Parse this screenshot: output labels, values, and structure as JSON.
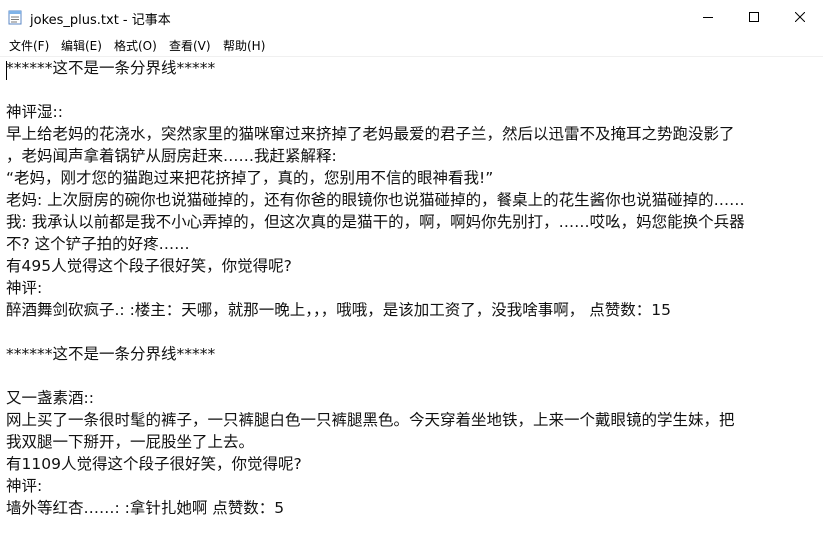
{
  "window": {
    "title": "jokes_plus.txt - 记事本",
    "icons": {
      "app": "notepad-icon",
      "minimize": "minimize-icon",
      "maximize": "maximize-icon",
      "close": "close-icon"
    }
  },
  "menu": {
    "items": [
      {
        "label": "文件(F)"
      },
      {
        "label": "编辑(E)"
      },
      {
        "label": "格式(O)"
      },
      {
        "label": "查看(V)"
      },
      {
        "label": "帮助(H)"
      }
    ]
  },
  "document": {
    "lines": [
      "******这不是一条分界线*****",
      "",
      "神评湿::",
      "早上给老妈的花浇水，突然家里的猫咪窜过来挤掉了老妈最爱的君子兰，然后以迅雷不及掩耳之势跑没影了",
      "，老妈闻声拿着锅铲从厨房赶来……我赶紧解释:",
      "“老妈，刚才您的猫跑过来把花挤掉了，真的，您别用不信的眼神看我!”",
      "老妈: 上次厨房的碗你也说猫碰掉的，还有你爸的眼镜你也说猫碰掉的，餐桌上的花生酱你也说猫碰掉的……",
      "我: 我承认以前都是我不小心弄掉的，但这次真的是猫干的，啊，啊妈你先别打，……哎吆，妈您能换个兵器",
      "不? 这个铲子拍的好疼……",
      "有495人觉得这个段子很好笑，你觉得呢?",
      "神评:",
      "醉酒舞剑砍疯子.: :楼主：天哪，就那一晚上，，，哦哦，是该加工资了，没我啥事啊，     点赞数：15",
      "",
      "******这不是一条分界线*****",
      "",
      "又一盏素酒::",
      "网上买了一条很时髦的裤子，一只裤腿白色一只裤腿黑色。今天穿着坐地铁，上来一个戴眼镜的学生妹，把",
      "我双腿一下掰开，一屁股坐了上去。",
      "有1109人觉得这个段子很好笑，你觉得呢?",
      "神评:",
      "墙外等红杏……: :拿针扎她啊    点赞数：5"
    ]
  }
}
